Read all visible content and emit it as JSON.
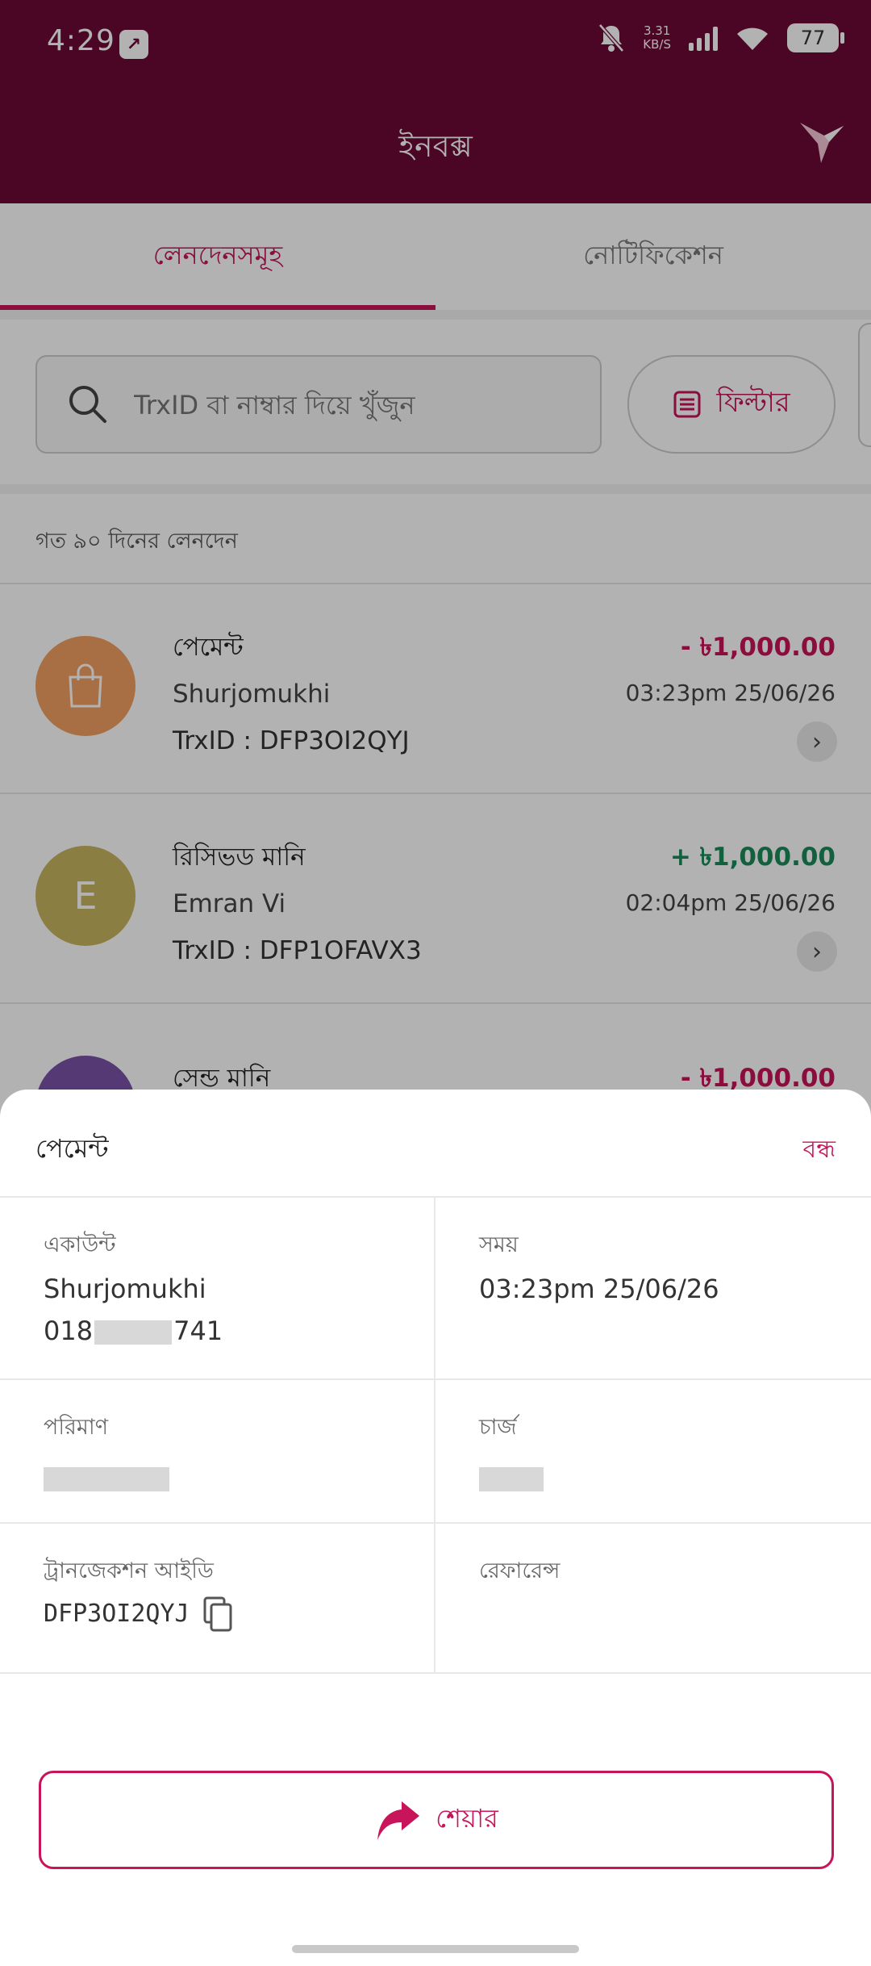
{
  "status_bar": {
    "time": "4:29",
    "speed_value": "3.31",
    "speed_unit": "KB/S",
    "battery": "77"
  },
  "app_bar": {
    "title": "ইনবক্স"
  },
  "tabs": [
    {
      "label": "লেনদেনসমূহ",
      "active": true
    },
    {
      "label": "নোটিফিকেশন",
      "active": false
    }
  ],
  "search": {
    "placeholder": "TrxID বা নাম্বার দিয়ে খুঁজুন",
    "filter_label": "ফিল্টার"
  },
  "period_label": "গত ৯০ দিনের লেনদেন",
  "transactions": [
    {
      "type": "পেমেন্ট",
      "name": "Shurjomukhi",
      "trx_id": "TrxID : DFP3OI2QYJ",
      "amount": "- ৳1,000.00",
      "time": "03:23pm 25/06/26",
      "avatar_color": "#f0a060"
    },
    {
      "type": "রিসিভড মানি",
      "name": "Emran Vi",
      "trx_id": "TrxID : DFP1OFAVX3",
      "amount": "+ ৳1,000.00",
      "time": "02:04pm 25/06/26",
      "avatar_letter": "E",
      "avatar_color": "#c8b560"
    },
    {
      "type": "সেন্ড মানি",
      "amount": "- ৳1,000.00",
      "avatar_color": "#7a52a8"
    }
  ],
  "sheet": {
    "title": "পেমেন্ট",
    "close_label": "বন্ধ",
    "account_label": "একাউন্ট",
    "account_name": "Shurjomukhi",
    "account_number_prefix": "018",
    "account_number_suffix": "741",
    "time_label": "সময়",
    "time_value": "03:23pm 25/06/26",
    "amount_label": "পরিমাণ",
    "charge_label": "চার্জ",
    "trx_label": "ট্রানজেকশন আইডি",
    "trx_value": "DFP3OI2QYJ",
    "reference_label": "রেফারেন্স",
    "share_label": "শেয়ার"
  },
  "colors": {
    "brand": "#6e0a35",
    "accent": "#c8145a",
    "positive": "#1a8a5a"
  }
}
